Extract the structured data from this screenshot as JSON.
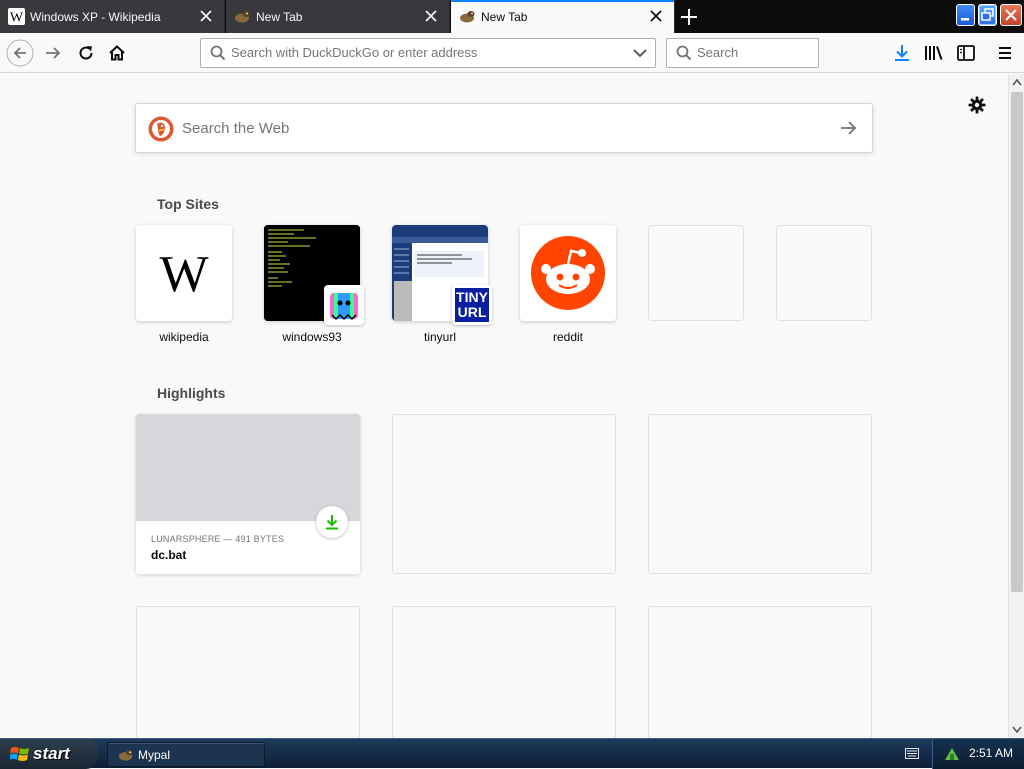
{
  "browser": {
    "tabs": [
      {
        "title": "Windows XP - Wikipedia",
        "icon": "wikipedia-favicon",
        "selected": false
      },
      {
        "title": "New Tab",
        "icon": "mypal-favicon",
        "selected": false
      },
      {
        "title": "New Tab",
        "icon": "mypal-favicon",
        "selected": true
      }
    ],
    "new_tab_icon": "plus-icon",
    "window_controls": [
      "minimize-icon",
      "restore-icon",
      "close-icon"
    ]
  },
  "toolbar": {
    "back_icon": "back-arrow-icon",
    "forward_icon": "forward-arrow-icon",
    "reload_icon": "reload-icon",
    "home_icon": "home-icon",
    "url_placeholder": "Search with DuckDuckGo or enter address",
    "search_placeholder": "Search",
    "download_icon": "download-icon",
    "library_icon": "library-icon",
    "sidebar_icon": "sidebar-icon",
    "menu_icon": "hamburger-menu-icon"
  },
  "newtab": {
    "search_placeholder": "Search the Web",
    "top_sites_title": "Top Sites",
    "top_sites": [
      {
        "label": "wikipedia"
      },
      {
        "label": "windows93"
      },
      {
        "label": "tinyurl"
      },
      {
        "label": "reddit"
      },
      {
        "label": ""
      },
      {
        "label": ""
      }
    ],
    "tinyurl_badge": "TINY URL",
    "highlights_title": "Highlights",
    "highlights": [
      {
        "host": "LUNARSPHERE — 491 BYTES",
        "title": "dc.bat"
      }
    ]
  },
  "taskbar": {
    "start_label": "start",
    "task_label": "Mypal",
    "clock": "2:51 AM"
  },
  "colors": {
    "accent": "#0a84ff",
    "download_green": "#12bc00",
    "reddit_orange": "#ff4500",
    "tab_strip": "#0c0c0d"
  }
}
